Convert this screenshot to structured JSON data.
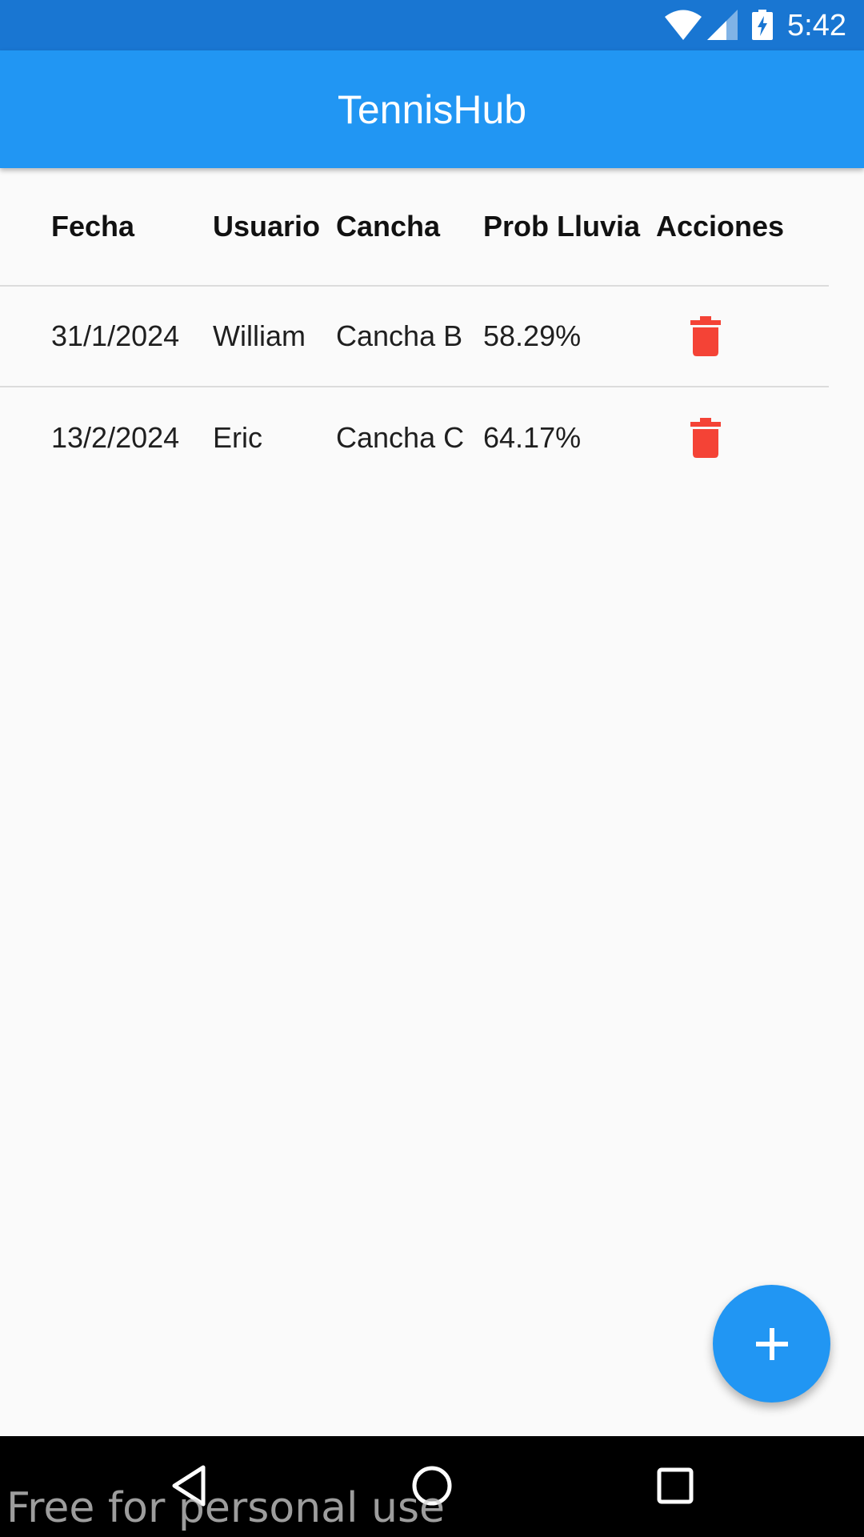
{
  "status_bar": {
    "time": "5:42",
    "icons": [
      "wifi-icon",
      "cell-signal-icon",
      "battery-charging-icon"
    ]
  },
  "app_bar": {
    "title": "TennisHub",
    "color": "#2196f3"
  },
  "table": {
    "columns": [
      "Fecha",
      "Usuario",
      "Cancha",
      "Prob Lluvia",
      "Acciones"
    ],
    "rows": [
      {
        "fecha": "31/1/2024",
        "usuario": "William",
        "cancha": "Cancha B",
        "prob_lluvia": "58.29%",
        "action_icon": "trash-icon"
      },
      {
        "fecha": "13/2/2024",
        "usuario": "Eric",
        "cancha": "Cancha C",
        "prob_lluvia": "64.17%",
        "action_icon": "trash-icon"
      }
    ]
  },
  "fab": {
    "icon": "plus-icon",
    "color": "#2196f3"
  },
  "nav_bar": {
    "icons": [
      "back-icon",
      "home-icon",
      "recents-icon"
    ]
  },
  "watermark": "Free for personal use",
  "colors": {
    "status_bar": "#1976d2",
    "delete_icon": "#f44336",
    "background": "#fafafa"
  }
}
